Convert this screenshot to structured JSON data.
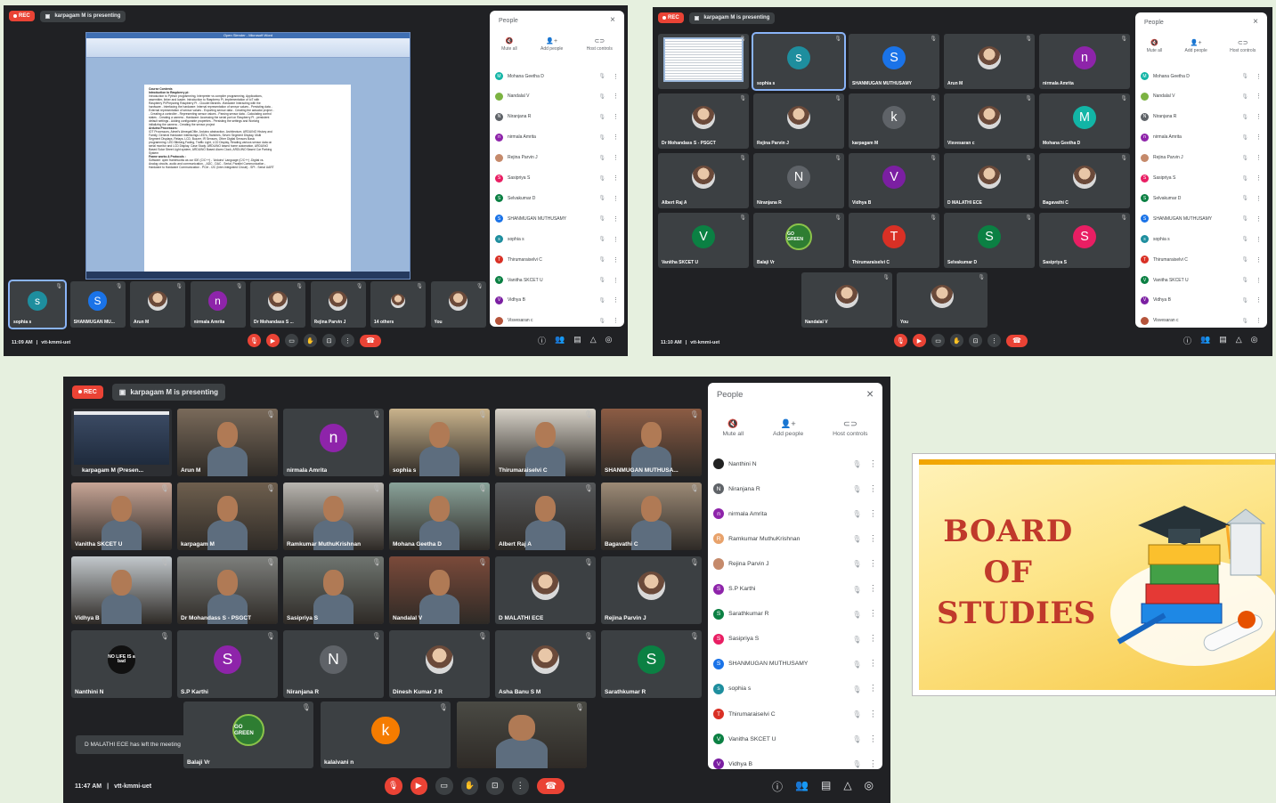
{
  "common": {
    "rec_label": "REC",
    "presenting": "karpagam M is presenting",
    "people_title": "People",
    "mute_all": "Mute all",
    "add_people": "Add people",
    "host_controls": "Host controls",
    "meeting_code": "vtt-kmmi-uet"
  },
  "panel1": {
    "time": "11:09 AM",
    "doc_title": "Open Slender - Microsoft Word",
    "doc_lines": [
      "Course Contents",
      "Introduction to Raspberry pi:",
      "Introduction to Python programming, Interpreter vs compiler programming, Applications,",
      "assembler, linker and loader. Introduction to Raspberry Pi, Implementation of IoT with",
      "Raspberry Pi/Preparing Raspberry Pi - Cloudel libraries -Hardware Interacting with the",
      "hardware - Interfacing the hardware: Internal representation of sensor values - Persisting data -",
      "External representation of sensor values - Exporting sensor data - Creating the actuator project -",
      "- Creating a controller - Representing sensor values - Parsing sensor data - Calculating control",
      "states - Creating a camera - Hardware: Accessing the serial port on Raspberry Pi - persistent",
      "default settings - Adding configurable properties - Persisting the settings and Working",
      "initializing the camera - Creating the sensor project",
      "",
      "Arduino Processors:",
      "IOT Processors, Atmel's AtmegaIOfile, Arduino abstraction, Architecture, ARDUINO History and",
      "Family, General Hardware interfacings LED's, Switches, Seven Segment Display, Multi",
      "Segment Displays, Relays, LCD, Buzzer, IR Sensors, Other Digital Sensors Basic",
      "programming: LED Blinking,Fading, Traffic Light, LCD Display, Reading various sensor data on",
      "serial monitor and LCD Display. Case Study: ARDUINO based home automation, ARDUINO",
      "Based Solar Street Light system, ARDUINO Based Alarm Clock, ARDUINO Based Car Parking",
      "System",
      "",
      "Frame works & Protocols :",
      "Software: open frameworks as our IDE (C/C++) - 'Arduino' Language (C/C++) -Digital vs.",
      "Analog circuits, audio and communication, - ADC - DAC - Serial, Parallel Communication -",
      "Hardware to Hardware Communication - PCIe - I2C (Inter-Integrated Circuit) - SPI - Serial UART"
    ],
    "tiles": [
      {
        "name": "sophia s",
        "kind": "avatar",
        "letter": "s",
        "color": "#1e8e9e"
      },
      {
        "name": "SHANMUGAN MU...",
        "kind": "avatar",
        "letter": "S",
        "color": "#1a73e8"
      },
      {
        "name": "Arun M",
        "kind": "photo"
      },
      {
        "name": "nirmala Amrita",
        "kind": "avatar",
        "letter": "n",
        "color": "#8e24aa"
      },
      {
        "name": "Dr Mohandass S ...",
        "kind": "photo"
      },
      {
        "name": "Rejina Parvin J",
        "kind": "photo"
      },
      {
        "name": "14 others",
        "kind": "others"
      },
      {
        "name": "You",
        "kind": "photo"
      }
    ],
    "people": [
      {
        "name": "Mohana Geetha D",
        "letter": "M",
        "color": "#12b5a6"
      },
      {
        "name": "Nandalal V",
        "letter": "",
        "color": "#7cb342"
      },
      {
        "name": "Niranjana R",
        "letter": "N",
        "color": "#5f6368"
      },
      {
        "name": "nirmala Amrita",
        "letter": "n",
        "color": "#8e24aa"
      },
      {
        "name": "Rejina Parvin J",
        "letter": "",
        "color": "#c58a6b"
      },
      {
        "name": "Sasipriya S",
        "letter": "S",
        "color": "#e91e63"
      },
      {
        "name": "Selvakumar D",
        "letter": "S",
        "color": "#0b8043"
      },
      {
        "name": "SHANMUGAN MUTHUSAMY",
        "letter": "S",
        "color": "#1a73e8"
      },
      {
        "name": "sophia s",
        "letter": "s",
        "color": "#1e8e9e"
      },
      {
        "name": "Thirumaraiselvi C",
        "letter": "T",
        "color": "#d93025"
      },
      {
        "name": "Vanitha SKCET U",
        "letter": "V",
        "color": "#0b8043"
      },
      {
        "name": "Vidhya B",
        "letter": "V",
        "color": "#7b1fa2"
      },
      {
        "name": "Visvesaran c",
        "letter": "",
        "color": "#b5543b"
      }
    ]
  },
  "panel2": {
    "time": "11:10 AM",
    "tiles": [
      {
        "name": "",
        "kind": "screen"
      },
      {
        "name": "sophia s",
        "kind": "avatar",
        "letter": "s",
        "color": "#1e8e9e"
      },
      {
        "name": "SHANMUGAN MUTHUSAMY",
        "kind": "avatar",
        "letter": "S",
        "color": "#1a73e8"
      },
      {
        "name": "Arun M",
        "kind": "photo"
      },
      {
        "name": "nirmala Amrita",
        "kind": "avatar",
        "letter": "n",
        "color": "#8e24aa"
      },
      {
        "name": "Dr Mohandass S - PSGCT",
        "kind": "photo"
      },
      {
        "name": "Rejina Parvin J",
        "kind": "photo"
      },
      {
        "name": "karpagam M",
        "kind": "avatar",
        "letter": "k",
        "color": "#5f6368"
      },
      {
        "name": "Visvesaran c",
        "kind": "photo"
      },
      {
        "name": "Mohana Geetha D",
        "kind": "avatar",
        "letter": "M",
        "color": "#12b5a6"
      },
      {
        "name": "Albert Raj A",
        "kind": "photo"
      },
      {
        "name": "Niranjana R",
        "kind": "avatar",
        "letter": "N",
        "color": "#5f6368"
      },
      {
        "name": "Vidhya B",
        "kind": "avatar",
        "letter": "V",
        "color": "#7b1fa2"
      },
      {
        "name": "D MALATHI ECE",
        "kind": "photo"
      },
      {
        "name": "Bagavathi C",
        "kind": "photo"
      },
      {
        "name": "Vanitha SKCET U",
        "kind": "avatar",
        "letter": "V",
        "color": "#0b8043"
      },
      {
        "name": "Balaji Vr",
        "kind": "gogreen"
      },
      {
        "name": "Thirumaraiselvi C",
        "kind": "avatar",
        "letter": "T",
        "color": "#d93025"
      },
      {
        "name": "Selvakumar D",
        "kind": "avatar",
        "letter": "S",
        "color": "#0b8043"
      },
      {
        "name": "Sasipriya S",
        "kind": "avatar",
        "letter": "S",
        "color": "#e91e63"
      },
      {
        "name": "Nandalal V",
        "kind": "photo"
      },
      {
        "name": "You",
        "kind": "photo"
      }
    ],
    "people": [
      {
        "name": "Mohana Geetha D",
        "letter": "M",
        "color": "#12b5a6"
      },
      {
        "name": "Nandalal V",
        "letter": "",
        "color": "#7cb342"
      },
      {
        "name": "Niranjana R",
        "letter": "N",
        "color": "#5f6368"
      },
      {
        "name": "nirmala Amrita",
        "letter": "n",
        "color": "#8e24aa"
      },
      {
        "name": "Rejina Parvin J",
        "letter": "",
        "color": "#c58a6b"
      },
      {
        "name": "Sasipriya S",
        "letter": "S",
        "color": "#e91e63"
      },
      {
        "name": "Selvakumar D",
        "letter": "S",
        "color": "#0b8043"
      },
      {
        "name": "SHANMUGAN MUTHUSAMY",
        "letter": "S",
        "color": "#1a73e8"
      },
      {
        "name": "sophia s",
        "letter": "s",
        "color": "#1e8e9e"
      },
      {
        "name": "Thirumaraiselvi C",
        "letter": "T",
        "color": "#d93025"
      },
      {
        "name": "Vanitha SKCET U",
        "letter": "V",
        "color": "#0b8043"
      },
      {
        "name": "Vidhya B",
        "letter": "V",
        "color": "#7b1fa2"
      },
      {
        "name": "Visvesaran c",
        "letter": "",
        "color": "#b5543b"
      }
    ]
  },
  "panel3": {
    "time": "11:47 AM",
    "toast": "D MALATHI ECE has left the meeting",
    "presenting_tile": "karpagam M (Presen...",
    "tiles": [
      {
        "name": "Arun M",
        "kind": "cam",
        "bg": "#7a6a5a"
      },
      {
        "name": "nirmala Amrita",
        "kind": "avatar",
        "letter": "n",
        "color": "#8e24aa"
      },
      {
        "name": "sophia s",
        "kind": "cam",
        "bg": "#c9b38c"
      },
      {
        "name": "Thirumaraiselvi C",
        "kind": "cam",
        "bg": "#d7d2c8"
      },
      {
        "name": "SHANMUGAN MUTHUSA...",
        "kind": "cam",
        "bg": "#8c5c44"
      },
      {
        "name": "Vanitha SKCET U",
        "kind": "cam",
        "bg": "#c7a596"
      },
      {
        "name": "karpagam M",
        "kind": "cam",
        "bg": "#6e5f4e"
      },
      {
        "name": "Ramkumar MuthuKrishnan",
        "kind": "cam",
        "bg": "#b9b6b0"
      },
      {
        "name": "Mohana Geetha D",
        "kind": "cam",
        "bg": "#8aa39a"
      },
      {
        "name": "Albert Raj A",
        "kind": "cam",
        "bg": "#56585a"
      },
      {
        "name": "Bagavathi C",
        "kind": "cam",
        "bg": "#9c8a76"
      },
      {
        "name": "Vidhya B",
        "kind": "cam",
        "bg": "#c2c8cc"
      },
      {
        "name": "Dr Mohandass S - PSGCT",
        "kind": "cam",
        "bg": "#7d7f7c"
      },
      {
        "name": "Sasipriya S",
        "kind": "cam",
        "bg": "#6f7570"
      },
      {
        "name": "Nandalal V",
        "kind": "cam",
        "bg": "#7b4a3a"
      },
      {
        "name": "D MALATHI ECE",
        "kind": "photo"
      },
      {
        "name": "Rejina Parvin J",
        "kind": "photo"
      },
      {
        "name": "Nanthini N",
        "kind": "lifebad"
      },
      {
        "name": "S.P Karthi",
        "kind": "avatar",
        "letter": "S",
        "color": "#8e24aa"
      },
      {
        "name": "Niranjana R",
        "kind": "avatar",
        "letter": "N",
        "color": "#5f6368"
      },
      {
        "name": "Dinesh Kumar J R",
        "kind": "photo"
      },
      {
        "name": "Asha Banu S M",
        "kind": "photo"
      },
      {
        "name": "Sarathkumar R",
        "kind": "avatar",
        "letter": "S",
        "color": "#0b8043"
      },
      {
        "name": "Balaji Vr",
        "kind": "gogreen"
      },
      {
        "name": "kalaivani n",
        "kind": "avatar",
        "letter": "k",
        "color": "#f57c00"
      },
      {
        "name": "",
        "kind": "cam",
        "bg": "#4a4a44"
      }
    ],
    "people": [
      {
        "name": "Nanthini N",
        "letter": "",
        "color": "#222"
      },
      {
        "name": "Niranjana R",
        "letter": "N",
        "color": "#5f6368"
      },
      {
        "name": "nirmala Amrita",
        "letter": "n",
        "color": "#8e24aa"
      },
      {
        "name": "Ramkumar MuthuKrishnan",
        "letter": "R",
        "color": "#e8a26b"
      },
      {
        "name": "Rejina Parvin J",
        "letter": "",
        "color": "#c58a6b"
      },
      {
        "name": "S.P Karthi",
        "letter": "S",
        "color": "#8e24aa"
      },
      {
        "name": "Sarathkumar R",
        "letter": "S",
        "color": "#0b8043"
      },
      {
        "name": "Sasipriya S",
        "letter": "S",
        "color": "#e91e63"
      },
      {
        "name": "SHANMUGAN MUTHUSAMY",
        "letter": "S",
        "color": "#1a73e8"
      },
      {
        "name": "sophia s",
        "letter": "s",
        "color": "#1e8e9e"
      },
      {
        "name": "Thirumaraiselvi C",
        "letter": "T",
        "color": "#d93025"
      },
      {
        "name": "Vanitha SKCET U",
        "letter": "V",
        "color": "#0b8043"
      },
      {
        "name": "Vidhya B",
        "letter": "V",
        "color": "#7b1fa2"
      }
    ]
  },
  "board": {
    "line1": "BOARD",
    "line2": "OF",
    "line3": "STUDIES"
  },
  "gogreen_label": "GO GREEN",
  "lifebad_label": "NO LIFE IS a bad"
}
